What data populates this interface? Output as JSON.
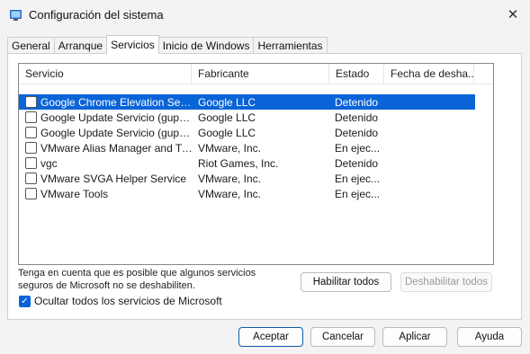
{
  "window": {
    "title": "Configuración del sistema",
    "close_glyph": "✕"
  },
  "tabs": [
    "General",
    "Arranque",
    "Servicios",
    "Inicio de Windows",
    "Herramientas"
  ],
  "list": {
    "columns": [
      "Servicio",
      "Fabricante",
      "Estado",
      "Fecha de desha..."
    ],
    "rows": [
      {
        "name": "Google Chrome Elevation Servic...",
        "manufacturer": "Google LLC",
        "state": "Detenido"
      },
      {
        "name": "Google Update Servicio (gupdate)",
        "manufacturer": "Google LLC",
        "state": "Detenido"
      },
      {
        "name": "Google Update Servicio (gupdat...",
        "manufacturer": "Google LLC",
        "state": "Detenido"
      },
      {
        "name": "VMware Alias Manager and Ticke...",
        "manufacturer": "VMware, Inc.",
        "state": "En ejec..."
      },
      {
        "name": "vgc",
        "manufacturer": "Riot Games, Inc.",
        "state": "Detenido"
      },
      {
        "name": "VMware SVGA Helper Service",
        "manufacturer": "VMware, Inc.",
        "state": "En ejec..."
      },
      {
        "name": "VMware Tools",
        "manufacturer": "VMware, Inc.",
        "state": "En ejec..."
      }
    ]
  },
  "note": "Tenga en cuenta que es posible que algunos servicios seguros de Microsoft no se deshabiliten.",
  "buttons": {
    "enable_all": "Habilitar todos",
    "disable_all": "Deshabilitar todos",
    "ok": "Aceptar",
    "cancel": "Cancelar",
    "apply": "Aplicar",
    "help": "Ayuda"
  },
  "hide_ms_label": "Ocultar todos los servicios de Microsoft",
  "hide_ms_checked_glyph": "✓",
  "colors": {
    "selection": "#0a64d8",
    "window_bg": "#f3f3f3"
  }
}
